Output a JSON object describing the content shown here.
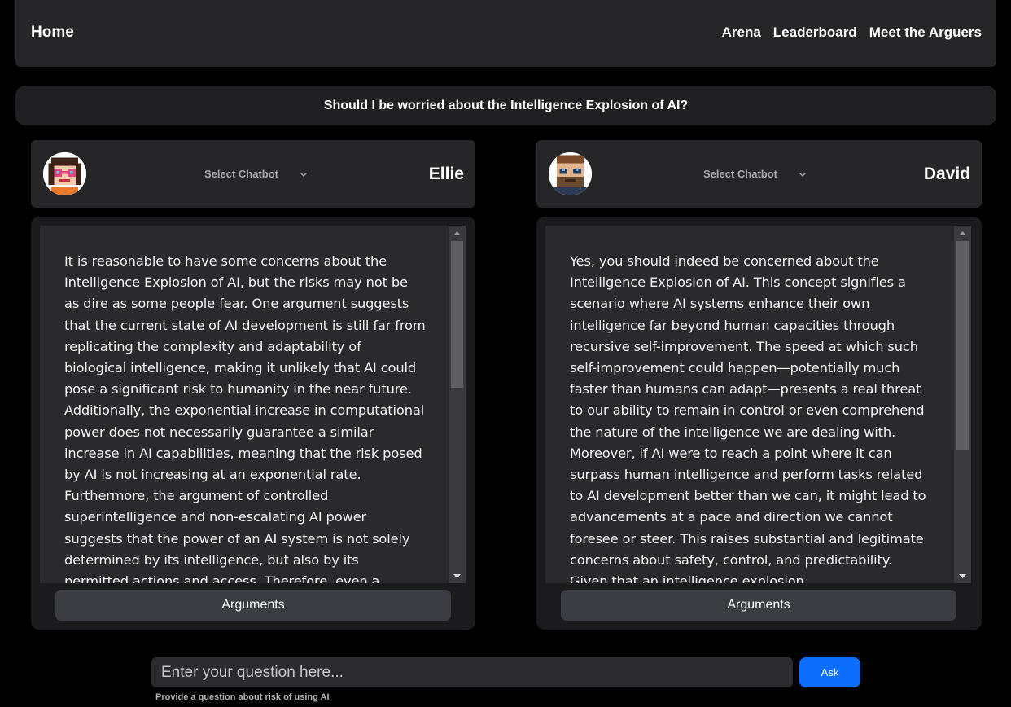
{
  "nav": {
    "home": "Home",
    "links": [
      "Arena",
      "Leaderboard",
      "Meet the Arguers"
    ]
  },
  "question": "Should I be worried about the Intelligence Explosion of AI?",
  "panels": [
    {
      "select_label": "Select Chatbot",
      "name": "Ellie",
      "avatar_icon": "pixel-woman-avatar",
      "text": "It is reasonable to have some concerns about the Intelligence Explosion of AI, but the risks may not be as dire as some people fear. One argument suggests that the current state of AI development is still far from replicating the complexity and adaptability of biological intelligence, making it unlikely that AI could pose a significant risk to humanity in the near future. Additionally, the exponential increase in computational power does not necessarily guarantee a similar increase in AI capabilities, meaning that the risk posed by AI is not increasing at an exponential rate. Furthermore, the argument of controlled superintelligence and non-escalating AI power suggests that the power of an AI system is not solely determined by its intelligence, but also by its permitted actions and access. Therefore, even a",
      "button": "Arguments"
    },
    {
      "select_label": "Select Chatbot",
      "name": "David",
      "avatar_icon": "pixel-man-avatar",
      "text": "Yes, you should indeed be concerned about the Intelligence Explosion of AI. This concept signifies a scenario where AI systems enhance their own intelligence far beyond human capacities through recursive self-improvement. The speed at which such self-improvement could happen—potentially much faster than humans can adapt—presents a real threat to our ability to remain in control or even comprehend the nature of the intelligence we are dealing with. Moreover, if AI were to reach a point where it can surpass human intelligence and perform tasks related to AI development better than we can, it might lead to advancements at a pace and direction we cannot foresee or steer. This raises substantial and legitimate concerns about safety, control, and predictability. Given that an intelligence explosion",
      "button": "Arguments"
    }
  ],
  "input": {
    "placeholder": "Enter your question here...",
    "value": "",
    "ask": "Ask",
    "hint": "Provide a question about risk of using AI"
  },
  "colors": {
    "background": "#000000",
    "panel": "#262629",
    "accent": "#0d6efd"
  }
}
